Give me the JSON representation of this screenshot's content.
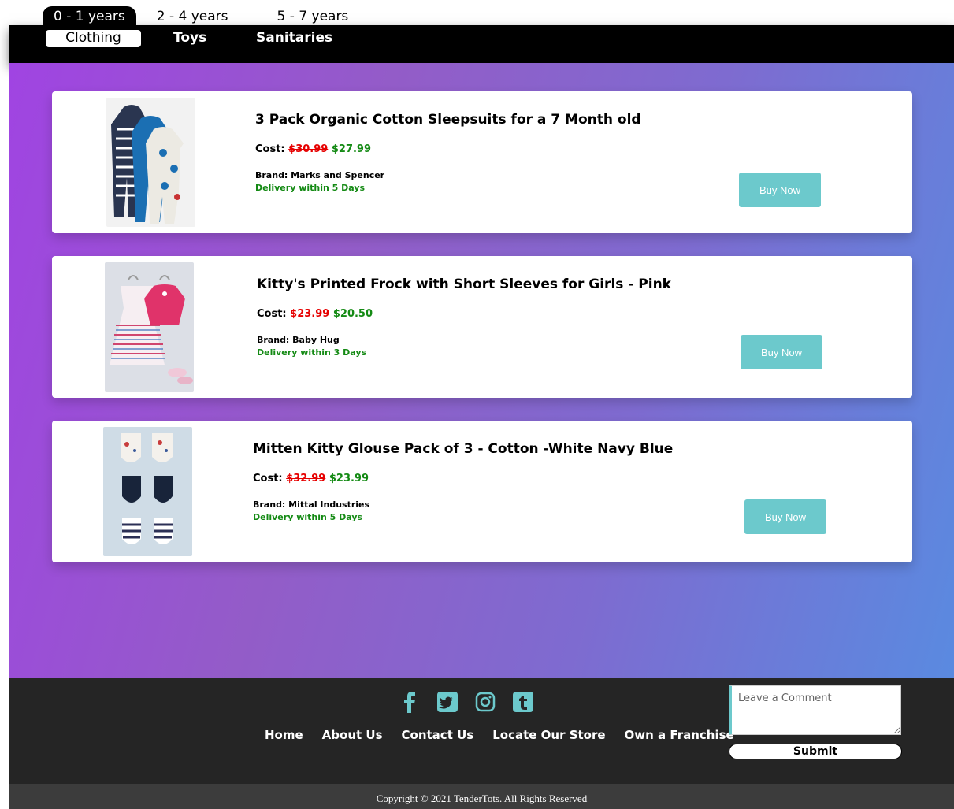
{
  "age_tabs": [
    "0 - 1 years",
    "2 - 4 years",
    "5 - 7 years"
  ],
  "categories": [
    "Clothing",
    "Toys",
    "Sanitaries"
  ],
  "cost_label": "Cost:",
  "products": [
    {
      "title": "3 Pack Organic Cotton Sleepsuits for a 7 Month old",
      "old_price": "$30.99",
      "new_price": "$27.99",
      "brand": "Brand: Marks and Spencer",
      "delivery": "Delivery within 5 Days",
      "button": "Buy Now"
    },
    {
      "title": "Kitty's Printed Frock with Short Sleeves for Girls - Pink",
      "old_price": "$23.99",
      "new_price": "$20.50",
      "brand": "Brand: Baby Hug",
      "delivery": "Delivery within 3 Days",
      "button": "Buy Now"
    },
    {
      "title": "Mitten Kitty Glouse Pack of 3 - Cotton -White Navy Blue",
      "old_price": "$32.99",
      "new_price": "$23.99",
      "brand": "Brand: Mittal Industries",
      "delivery": "Delivery within 5 Days",
      "button": "Buy Now"
    }
  ],
  "footer": {
    "social_icons": [
      "facebook-icon",
      "twitter-icon",
      "instagram-icon",
      "tumblr-icon"
    ],
    "links": [
      "Home",
      "About Us",
      "Contact Us",
      "Locate Our Store",
      "Own a Franchise"
    ],
    "comment_placeholder": "Leave a Comment",
    "submit_label": "Submit",
    "copyright": "Copyright © 2021 TenderTots. All Rights Reserved"
  },
  "colors": {
    "accent": "#6cc9cc",
    "price_old": "#e60000",
    "price_new": "#148a14",
    "footer_bg": "#252525"
  }
}
